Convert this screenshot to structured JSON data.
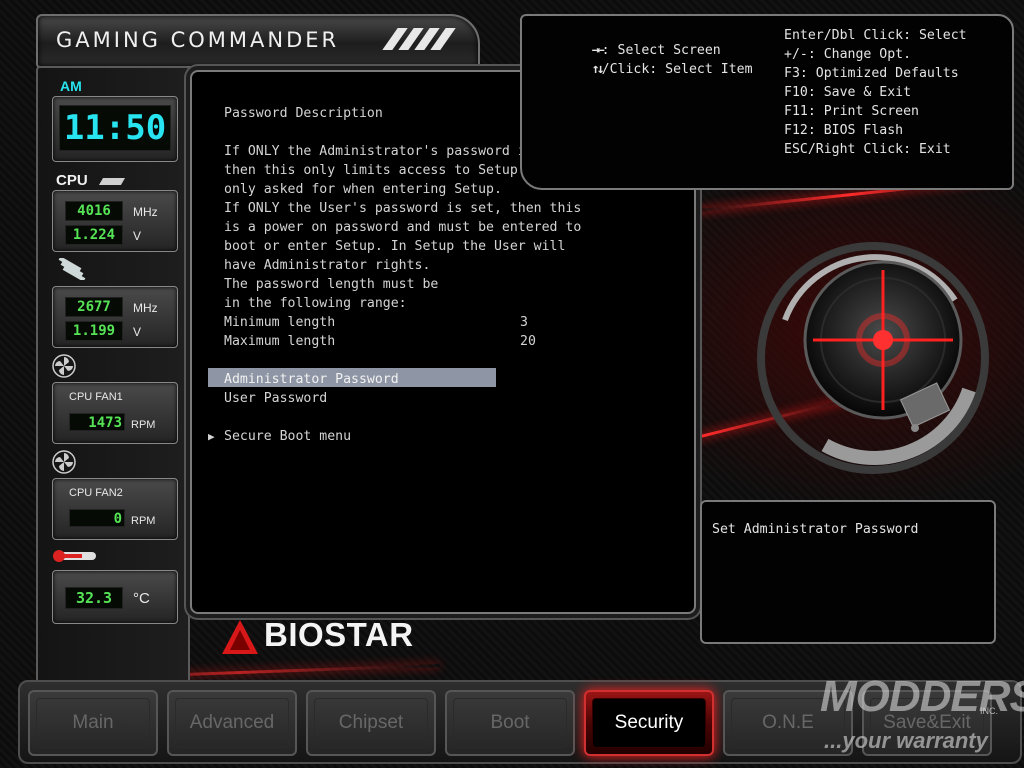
{
  "app": {
    "title": "GAMING COMMANDER"
  },
  "sidebar": {
    "clock": {
      "period": "AM",
      "time": "11:50"
    },
    "cpu": {
      "label": "CPU",
      "frequency": "4016",
      "frequency_unit": "MHz",
      "voltage": "1.224",
      "voltage_unit": "V"
    },
    "memory": {
      "frequency": "2677",
      "frequency_unit": "MHz",
      "voltage": "1.199",
      "voltage_unit": "V"
    },
    "fan1": {
      "label": "CPU FAN1",
      "value": "1473",
      "unit": "RPM"
    },
    "fan2": {
      "label": "CPU FAN2",
      "value": "0",
      "unit": "RPM"
    },
    "temperature": {
      "value": "32.3",
      "unit": "°C"
    }
  },
  "main": {
    "heading": "Password Description",
    "description": [
      "If ONLY the Administrator's password is set,",
      "then this only limits access to Setup and is",
      "only asked for when entering Setup.",
      "If ONLY the User's password is set, then this",
      "is a power on password and must be entered to",
      "boot or enter Setup. In Setup the User will",
      "have Administrator rights.",
      "The password length must be",
      "in the following range:"
    ],
    "min_label": "Minimum length",
    "min_value": "3",
    "max_label": "Maximum length",
    "max_value": "20",
    "items": [
      {
        "label": "Administrator Password",
        "selected": true
      },
      {
        "label": "User Password",
        "selected": false
      }
    ],
    "submenu": {
      "marker": "▶",
      "label": "Secure Boot menu"
    }
  },
  "help": {
    "left": [
      {
        "keys": "→←",
        "text": ": Select Screen"
      },
      {
        "keys": "↑↓",
        "text": "/Click: Select Item"
      }
    ],
    "right": [
      "Enter/Dbl Click: Select",
      "+/-: Change Opt.",
      "F3: Optimized Defaults",
      "F10: Save & Exit",
      "F11: Print Screen",
      "F12: BIOS Flash",
      "ESC/Right Click: Exit"
    ]
  },
  "info": {
    "text": "Set Administrator Password"
  },
  "brand": {
    "name": "BIOSTAR"
  },
  "tabs": [
    {
      "label": "Main",
      "active": false
    },
    {
      "label": "Advanced",
      "active": false
    },
    {
      "label": "Chipset",
      "active": false
    },
    {
      "label": "Boot",
      "active": false
    },
    {
      "label": "Security",
      "active": true
    },
    {
      "label": "O.N.E",
      "active": false
    },
    {
      "label": "Save&Exit",
      "active": false
    }
  ],
  "watermark": {
    "main": "MODDERS",
    "sub": "INC.",
    "tagline": "...your warranty"
  },
  "colors": {
    "accent": "#ff2020",
    "lcd_green": "#56e456",
    "lcd_cyan": "#27e4f0",
    "highlight": "#8e95a4"
  }
}
